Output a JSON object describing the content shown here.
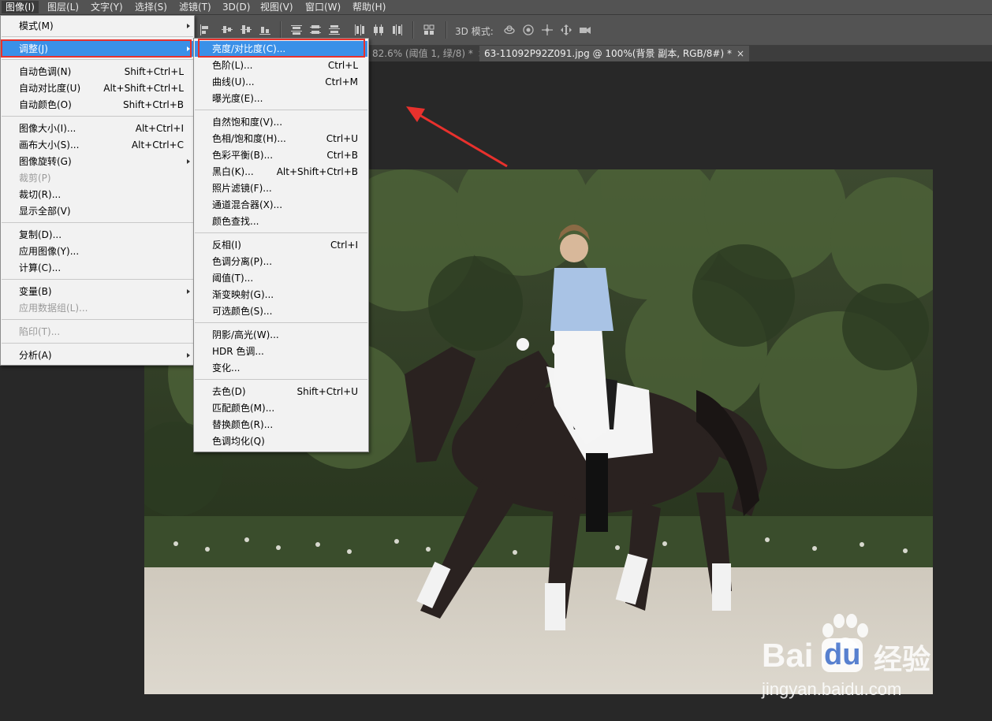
{
  "menubar": {
    "items": [
      {
        "label": "图像(I)",
        "active": true
      },
      {
        "label": "图层(L)"
      },
      {
        "label": "文字(Y)"
      },
      {
        "label": "选择(S)"
      },
      {
        "label": "滤镜(T)"
      },
      {
        "label": "3D(D)"
      },
      {
        "label": "视图(V)"
      },
      {
        "label": "窗口(W)"
      },
      {
        "label": "帮助(H)"
      }
    ]
  },
  "options_bar": {
    "mode_3d_label": "3D 模式:"
  },
  "tabs": [
    {
      "label": "82.6% (阈值 1, 绿/8) *",
      "close": "×"
    },
    {
      "label": "63-11092P92Z091.jpg @ 100%(背景 副本, RGB/8#) *",
      "close": "×"
    }
  ],
  "image_menu": {
    "items": [
      {
        "label": "模式(M)",
        "shortcut": "",
        "submenu": true
      },
      {
        "label": "调整(J)",
        "shortcut": "",
        "submenu": true,
        "highlight": true
      },
      {
        "label": "自动色调(N)",
        "shortcut": "Shift+Ctrl+L"
      },
      {
        "label": "自动对比度(U)",
        "shortcut": "Alt+Shift+Ctrl+L"
      },
      {
        "label": "自动颜色(O)",
        "shortcut": "Shift+Ctrl+B"
      },
      {
        "label": "图像大小(I)...",
        "shortcut": "Alt+Ctrl+I"
      },
      {
        "label": "画布大小(S)...",
        "shortcut": "Alt+Ctrl+C"
      },
      {
        "label": "图像旋转(G)",
        "shortcut": "",
        "submenu": true
      },
      {
        "label": "裁剪(P)",
        "shortcut": "",
        "disabled": true
      },
      {
        "label": "裁切(R)...",
        "shortcut": ""
      },
      {
        "label": "显示全部(V)",
        "shortcut": ""
      },
      {
        "label": "复制(D)...",
        "shortcut": ""
      },
      {
        "label": "应用图像(Y)...",
        "shortcut": ""
      },
      {
        "label": "计算(C)...",
        "shortcut": ""
      },
      {
        "label": "变量(B)",
        "shortcut": "",
        "submenu": true
      },
      {
        "label": "应用数据组(L)...",
        "shortcut": "",
        "disabled": true
      },
      {
        "label": "陷印(T)...",
        "shortcut": "",
        "disabled": true
      },
      {
        "label": "分析(A)",
        "shortcut": "",
        "submenu": true
      }
    ]
  },
  "adjust_menu": {
    "items": [
      {
        "label": "亮度/对比度(C)...",
        "shortcut": "",
        "highlight": true
      },
      {
        "label": "色阶(L)...",
        "shortcut": "Ctrl+L"
      },
      {
        "label": "曲线(U)...",
        "shortcut": "Ctrl+M"
      },
      {
        "label": "曝光度(E)...",
        "shortcut": ""
      },
      {
        "label": "自然饱和度(V)...",
        "shortcut": ""
      },
      {
        "label": "色相/饱和度(H)...",
        "shortcut": "Ctrl+U"
      },
      {
        "label": "色彩平衡(B)...",
        "shortcut": "Ctrl+B"
      },
      {
        "label": "黑白(K)...",
        "shortcut": "Alt+Shift+Ctrl+B"
      },
      {
        "label": "照片滤镜(F)...",
        "shortcut": ""
      },
      {
        "label": "通道混合器(X)...",
        "shortcut": ""
      },
      {
        "label": "颜色查找...",
        "shortcut": ""
      },
      {
        "label": "反相(I)",
        "shortcut": "Ctrl+I"
      },
      {
        "label": "色调分离(P)...",
        "shortcut": ""
      },
      {
        "label": "阈值(T)...",
        "shortcut": ""
      },
      {
        "label": "渐变映射(G)...",
        "shortcut": ""
      },
      {
        "label": "可选颜色(S)...",
        "shortcut": ""
      },
      {
        "label": "阴影/高光(W)...",
        "shortcut": ""
      },
      {
        "label": "HDR 色调...",
        "shortcut": ""
      },
      {
        "label": "变化...",
        "shortcut": ""
      },
      {
        "label": "去色(D)",
        "shortcut": "Shift+Ctrl+U"
      },
      {
        "label": "匹配颜色(M)...",
        "shortcut": ""
      },
      {
        "label": "替换颜色(R)...",
        "shortcut": ""
      },
      {
        "label": "色调均化(Q)",
        "shortcut": ""
      }
    ]
  },
  "watermark": {
    "brand_a": "Bai",
    "brand_b": "du",
    "brand_cn": "经验",
    "url": "jingyan.baidu.com"
  },
  "colors": {
    "menu_highlight": "#3a90e8",
    "annotation_red": "#e8312d",
    "menubar_bg": "#535353",
    "workspace_bg": "#282828"
  }
}
